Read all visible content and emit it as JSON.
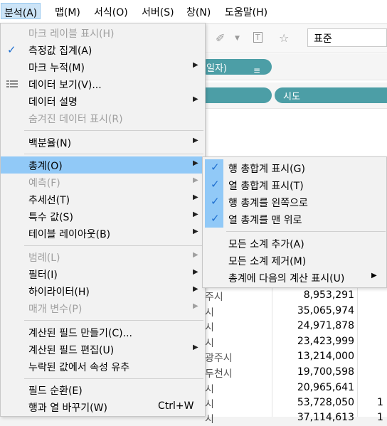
{
  "menubar": {
    "items": [
      "분석(A)",
      "맵(M)",
      "서식(O)",
      "서버(S)",
      "창(N)",
      "도움말(H)"
    ]
  },
  "toolbar": {
    "font_value": "표준",
    "icons": [
      "paperclip-icon",
      "text-box-icon",
      "pin-icon"
    ]
  },
  "shelves": {
    "pill1": "일자)",
    "pill2": "시도"
  },
  "table": {
    "rows": [
      {
        "name": "주시",
        "value": "8,953,291",
        "extra": ""
      },
      {
        "name": "시",
        "value": "35,065,974",
        "extra": ""
      },
      {
        "name": "시",
        "value": "24,971,878",
        "extra": ""
      },
      {
        "name": "시",
        "value": "23,423,999",
        "extra": ""
      },
      {
        "name": "광주시",
        "value": "13,214,000",
        "extra": ""
      },
      {
        "name": "두천시",
        "value": "19,700,598",
        "extra": ""
      },
      {
        "name": "시",
        "value": "20,965,641",
        "extra": ""
      },
      {
        "name": "시",
        "value": "53,728,050",
        "extra": "1"
      },
      {
        "name": "시",
        "value": "37,114,613",
        "extra": "1"
      }
    ]
  },
  "menu": {
    "items": [
      {
        "label": "마크 레이블 표시(H)",
        "disabled": true
      },
      {
        "label": "측정값 집계(A)",
        "checked": true
      },
      {
        "label": "마크 누적(M)",
        "submenu": true
      },
      {
        "label": "데이터 보기(V)...",
        "icon": "view-data-icon"
      },
      {
        "label": "데이터 설명",
        "submenu": true
      },
      {
        "label": "숨겨진 데이터 표시(R)",
        "disabled": true
      },
      {
        "label": "백분율(N)",
        "submenu": true
      },
      {
        "label": "총계(O)",
        "submenu": true,
        "highlighted": true
      },
      {
        "label": "예측(F)",
        "submenu": true,
        "disabled": true
      },
      {
        "label": "추세선(T)",
        "submenu": true
      },
      {
        "label": "특수 값(S)",
        "submenu": true
      },
      {
        "label": "테이블 레이아웃(B)",
        "submenu": true
      },
      {
        "label": "범례(L)",
        "submenu": true,
        "disabled": true
      },
      {
        "label": "필터(I)",
        "submenu": true
      },
      {
        "label": "하이라이터(H)",
        "submenu": true
      },
      {
        "label": "매개 변수(P)",
        "submenu": true,
        "disabled": true
      },
      {
        "label": "계산된 필드 만들기(C)..."
      },
      {
        "label": "계산된 필드 편집(U)",
        "submenu": true
      },
      {
        "label": "누락된 값에서 속성 유추"
      },
      {
        "label": "필드 순환(E)"
      },
      {
        "label": "행과 열 바꾸기(W)",
        "shortcut": "Ctrl+W"
      }
    ]
  },
  "submenu": {
    "items": [
      {
        "label": "행 총합계 표시(G)",
        "checked": true
      },
      {
        "label": "열 총합계 표시(T)",
        "checked": true
      },
      {
        "label": "행 총계를 왼쪽으로",
        "checked": true
      },
      {
        "label": "열 총계를 맨 위로",
        "checked": true
      },
      {
        "label": "모든 소계 추가(A)"
      },
      {
        "label": "모든 소계 제거(M)"
      },
      {
        "label": "총계에 다음의 계산 표시(U)",
        "submenu": true
      }
    ]
  },
  "colors": {
    "highlight": "#91c9f7",
    "check": "#1e6fd0",
    "pill": "#4c9ea6"
  }
}
